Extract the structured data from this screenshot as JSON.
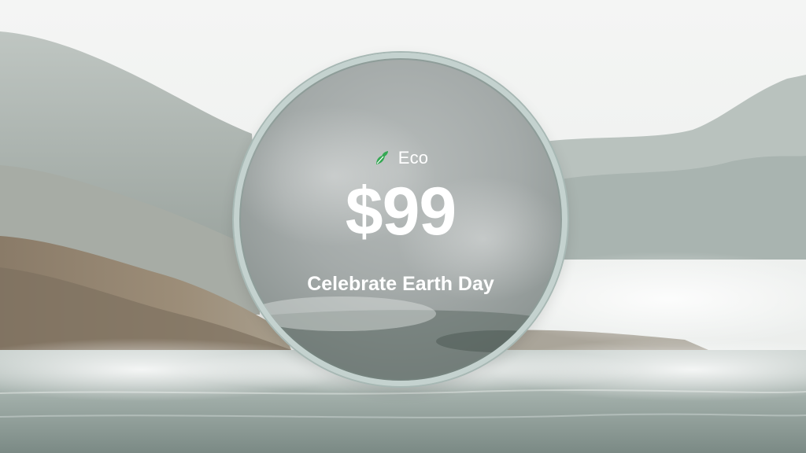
{
  "promo": {
    "mode_label": "Eco",
    "mode_icon": "leaf-icon",
    "price": "$99",
    "tagline": "Celebrate Earth Day"
  },
  "colors": {
    "leaf_green": "#34a853",
    "ring": "#c4d2cf",
    "text": "#ffffff"
  }
}
